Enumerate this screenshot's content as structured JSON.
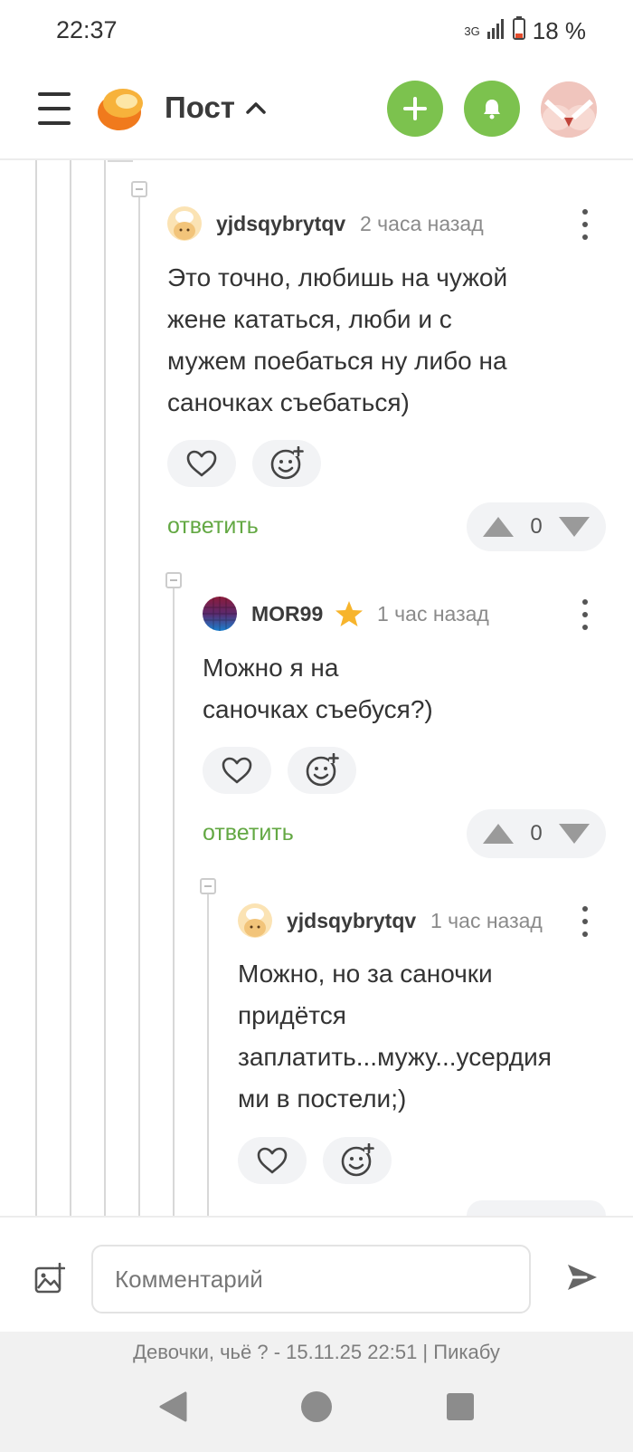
{
  "status": {
    "time": "22:37",
    "network": "3G",
    "battery": "18 %"
  },
  "header": {
    "title": "Пост"
  },
  "comments": [
    {
      "user": "yjdsqybrytqv",
      "time": "2 часа назад",
      "lines": [
        "Это точно, любишь на чужой",
        "жене кататься, люби и с",
        "мужем поебаться ну либо на",
        "саночках съебаться)"
      ],
      "reply": "ответить",
      "rating": "0"
    },
    {
      "user": "MOR99",
      "time": "1 час назад",
      "lines": [
        "Можно я на",
        "саночках съебуся?)"
      ],
      "reply": "ответить",
      "rating": "0"
    },
    {
      "user": "yjdsqybrytqv",
      "time": "1 час назад",
      "lines": [
        "Можно, но за саночки",
        "придётся",
        "заплатить...мужу...усердия",
        "ми в постели;)"
      ]
    }
  ],
  "composer": {
    "placeholder": "Комментарий"
  },
  "footer": {
    "text": "Девочки, чьё ? - 15.11.25 22:51 | Пикабу"
  },
  "colors": {
    "accent": "#7cc24e",
    "reply": "#63a843"
  }
}
